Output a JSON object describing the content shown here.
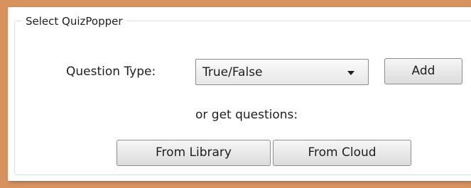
{
  "group": {
    "title": "Select QuizPopper"
  },
  "question_type": {
    "label": "Question Type:",
    "selected": "True/False"
  },
  "buttons": {
    "add": "Add",
    "from_library": "From Library",
    "from_cloud": "From Cloud"
  },
  "text": {
    "or_get_questions": "or get questions:"
  },
  "colors": {
    "frame_border": "#d8925e",
    "group_border": "#d5dfe5"
  }
}
